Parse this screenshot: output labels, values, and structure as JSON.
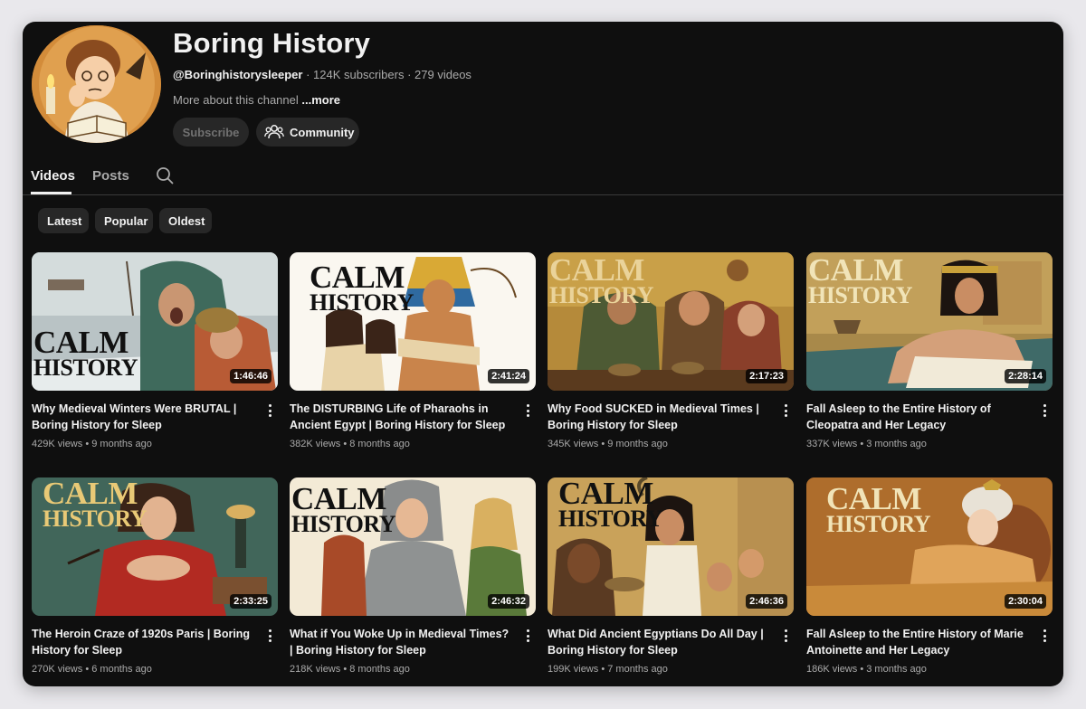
{
  "channel": {
    "name": "Boring History",
    "handle": "@Boringhistorysleeper",
    "subscribers": "124K subscribers",
    "videos_count": "279 videos",
    "about": "More about this channel",
    "more_link": "...more",
    "subscribe_label": "Subscribe",
    "community_label": "Community"
  },
  "tabs": {
    "videos": "Videos",
    "posts": "Posts"
  },
  "filters": {
    "latest": "Latest",
    "popular": "Popular",
    "oldest": "Oldest"
  },
  "badge": {
    "word1": "CALM",
    "word2": "HISTORY"
  },
  "videos": [
    {
      "title": "Why Medieval Winters Were BRUTAL | Boring History for Sleep",
      "views": "429K views",
      "age": "9 months ago",
      "duration": "1:46:46"
    },
    {
      "title": "The DISTURBING Life of Pharaohs in Ancient Egypt | Boring History for Sleep",
      "views": "382K views",
      "age": "8 months ago",
      "duration": "2:41:24"
    },
    {
      "title": "Why Food SUCKED in Medieval Times | Boring History for Sleep",
      "views": "345K views",
      "age": "9 months ago",
      "duration": "2:17:23"
    },
    {
      "title": "Fall Asleep to the Entire History of Cleopatra and Her Legacy",
      "views": "337K views",
      "age": "3 months ago",
      "duration": "2:28:14"
    },
    {
      "title": "The Heroin Craze of 1920s Paris | Boring History for Sleep",
      "views": "270K views",
      "age": "6 months ago",
      "duration": "2:33:25"
    },
    {
      "title": "What if You Woke Up in Medieval Times? | Boring History for Sleep",
      "views": "218K views",
      "age": "8 months ago",
      "duration": "2:46:32"
    },
    {
      "title": "What Did Ancient Egyptians Do All Day | Boring History for Sleep",
      "views": "199K views",
      "age": "7 months ago",
      "duration": "2:46:36"
    },
    {
      "title": "Fall Asleep to the Entire History of Marie Antoinette and Her Legacy",
      "views": "186K views",
      "age": "3 months ago",
      "duration": "2:30:04"
    }
  ],
  "colors": {
    "background": "#0f0f0f",
    "chip": "#272727",
    "text": "#f1f1f1",
    "secondary_text": "#aaaaaa"
  }
}
